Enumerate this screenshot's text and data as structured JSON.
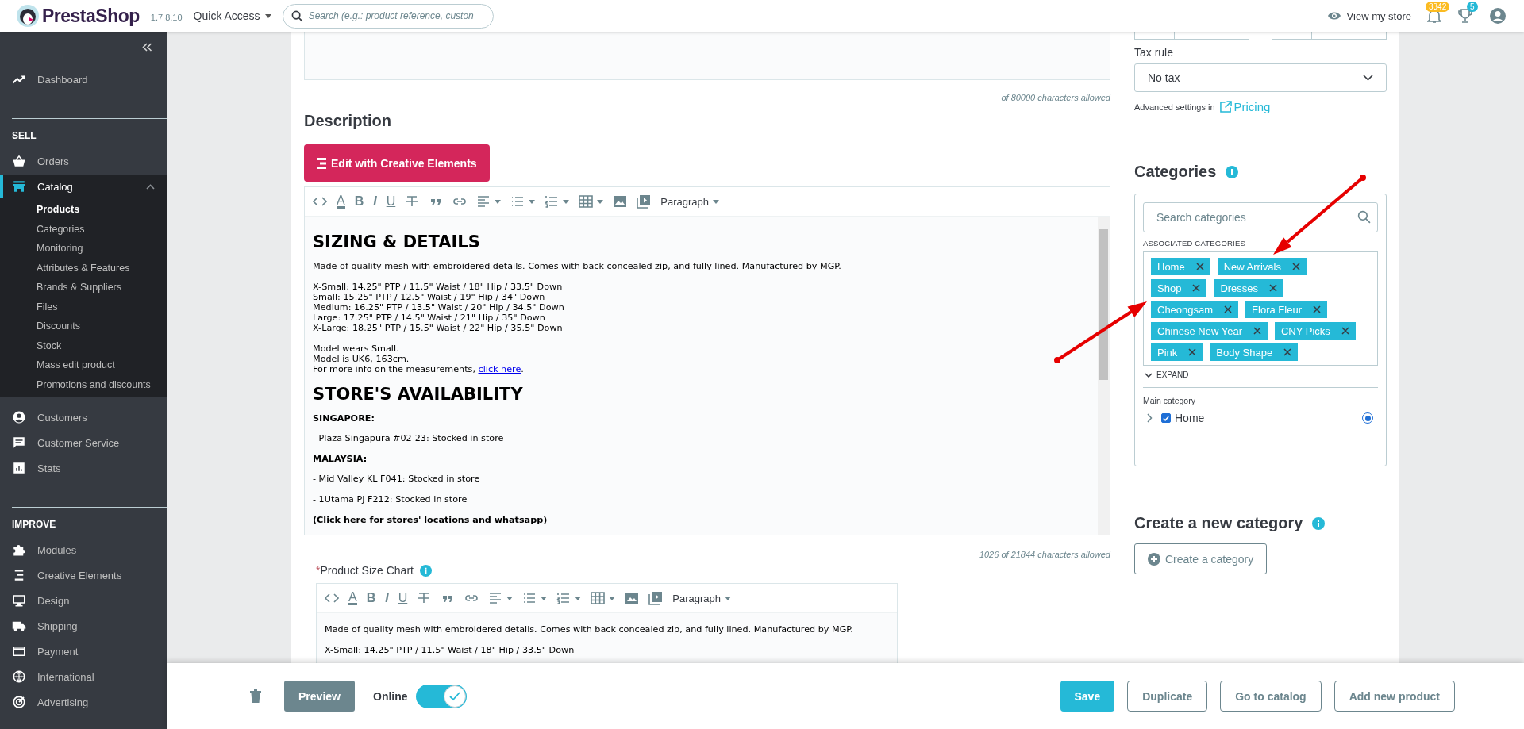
{
  "header": {
    "logo": "PrestaShop",
    "version": "1.7.8.10",
    "quick_access": "Quick Access",
    "search_placeholder": "Search (e.g.: product reference, custon",
    "view_store": "View my store",
    "notifications_badge": "3342",
    "trophy_badge": "5"
  },
  "sidebar": {
    "sections": [
      {
        "items": [
          {
            "label": "Dashboard",
            "selected": false
          }
        ]
      },
      {
        "title": "SELL",
        "items": [
          {
            "label": "Orders",
            "selected": false
          },
          {
            "label": "Catalog",
            "selected": true,
            "expanded": true,
            "children": [
              {
                "label": "Products",
                "selected": true
              },
              {
                "label": "Categories",
                "selected": false
              },
              {
                "label": "Monitoring",
                "selected": false
              },
              {
                "label": "Attributes & Features",
                "selected": false
              },
              {
                "label": "Brands & Suppliers",
                "selected": false
              },
              {
                "label": "Files",
                "selected": false
              },
              {
                "label": "Discounts",
                "selected": false
              },
              {
                "label": "Stock",
                "selected": false
              },
              {
                "label": "Mass edit product",
                "selected": false
              },
              {
                "label": "Promotions and discounts",
                "selected": false
              }
            ]
          },
          {
            "label": "Customers",
            "selected": false
          },
          {
            "label": "Customer Service",
            "selected": false
          },
          {
            "label": "Stats",
            "selected": false
          }
        ]
      },
      {
        "title": "IMPROVE",
        "items": [
          {
            "label": "Modules",
            "selected": false
          },
          {
            "label": "Creative Elements",
            "selected": false
          },
          {
            "label": "Design",
            "selected": false
          },
          {
            "label": "Shipping",
            "selected": false
          },
          {
            "label": "Payment",
            "selected": false
          },
          {
            "label": "International",
            "selected": false
          },
          {
            "label": "Advertising",
            "selected": false
          }
        ]
      }
    ]
  },
  "summary": {
    "counter": "of 80000 characters allowed"
  },
  "description": {
    "title": "Description",
    "button": "Edit with Creative Elements",
    "toolbar": [
      {
        "kind": "code",
        "caret": false
      },
      {
        "kind": "color_letter",
        "text": "A",
        "caret": false
      },
      {
        "kind": "bold_letter",
        "text": "B",
        "caret": false
      },
      {
        "kind": "italic_letter",
        "text": "I",
        "caret": false
      },
      {
        "kind": "underline_letter",
        "text": "U",
        "caret": false
      },
      {
        "kind": "strike",
        "caret": false
      },
      {
        "kind": "quote",
        "caret": false
      },
      {
        "kind": "link",
        "caret": false
      },
      {
        "kind": "align",
        "caret": true
      },
      {
        "kind": "bullets",
        "caret": true
      },
      {
        "kind": "numbers",
        "caret": true
      },
      {
        "kind": "table",
        "caret": true
      },
      {
        "kind": "image",
        "caret": false
      },
      {
        "kind": "media",
        "caret": false
      },
      {
        "kind": "format",
        "text": "Paragraph",
        "caret": true
      }
    ],
    "content": [
      {
        "kind": "heading",
        "text": "SIZING & DETAILS"
      },
      {
        "kind": "paragraph",
        "lines": [
          {
            "text": "Made of quality mesh with embroidered details. Comes with back concealed zip, and fully lined. Manufactured by MGP."
          }
        ]
      },
      {
        "kind": "paragraph",
        "lines": [
          {
            "text": "X-Small: 14.25\" PTP / 11.5\" Waist / 18\" Hip / 33.5\" Down"
          },
          {
            "text": "Small: 15.25\" PTP / 12.5\" Waist / 19\" Hip / 34\" Down"
          },
          {
            "text": "Medium: 16.25\" PTP / 13.5\" Waist / 20\" Hip / 34.5\" Down"
          },
          {
            "text": "Large: 17.25\" PTP / 14.5\" Waist / 21\" Hip / 35\" Down"
          },
          {
            "text": "X-Large: 18.25\" PTP / 15.5\" Waist / 22\" Hip / 35.5\" Down"
          }
        ]
      },
      {
        "kind": "paragraph",
        "lines": [
          {
            "text": "Model wears Small."
          },
          {
            "text": "Model is UK6, 163cm."
          },
          {
            "text": "For more info on the measurements, ",
            "link": "click here",
            "after": "."
          }
        ]
      },
      {
        "kind": "heading",
        "text": "STORE'S AVAILABILITY"
      },
      {
        "kind": "strong",
        "text": "SINGAPORE:"
      },
      {
        "kind": "paragraph",
        "lines": [
          {
            "text": "- Plaza Singapura #02-23: Stocked in store"
          }
        ]
      },
      {
        "kind": "strong",
        "text": "MALAYSIA:"
      },
      {
        "kind": "paragraph",
        "lines": [
          {
            "text": "- Mid Valley KL F041: Stocked in store"
          }
        ]
      },
      {
        "kind": "paragraph",
        "lines": [
          {
            "text": "- 1Utama PJ F212: Stocked in store"
          }
        ]
      },
      {
        "kind": "strong",
        "text": "(Click here for stores' locations and whatsapp)"
      }
    ],
    "counter": "1026 of 21844 characters allowed"
  },
  "size_chart": {
    "required_mark": "*",
    "label": "Product Size Chart",
    "toolbar": [
      {
        "kind": "code",
        "caret": false
      },
      {
        "kind": "color_letter",
        "text": "A",
        "caret": false
      },
      {
        "kind": "bold_letter",
        "text": "B",
        "caret": false
      },
      {
        "kind": "italic_letter",
        "text": "I",
        "caret": false
      },
      {
        "kind": "underline_letter",
        "text": "U",
        "caret": false
      },
      {
        "kind": "strike",
        "caret": false
      },
      {
        "kind": "quote",
        "caret": false
      },
      {
        "kind": "link",
        "caret": false
      },
      {
        "kind": "align",
        "caret": true
      },
      {
        "kind": "bullets",
        "caret": true
      },
      {
        "kind": "numbers",
        "caret": true
      },
      {
        "kind": "table",
        "caret": true
      },
      {
        "kind": "image",
        "caret": false
      },
      {
        "kind": "media",
        "caret": false
      },
      {
        "kind": "format",
        "text": "Paragraph",
        "caret": true
      }
    ],
    "content": [
      {
        "kind": "paragraph",
        "lines": [
          {
            "text": "Made of quality mesh with embroidered details. Comes with back concealed zip, and fully lined. Manufactured by MGP."
          }
        ]
      },
      {
        "kind": "paragraph",
        "lines": [
          {
            "text": "X-Small: 14.25\" PTP / 11.5\" Waist / 18\" Hip / 33.5\" Down"
          }
        ]
      }
    ]
  },
  "tax_rule": {
    "label": "Tax rule",
    "value": "No tax"
  },
  "advanced": {
    "text": "Advanced settings in",
    "link": "Pricing"
  },
  "categories": {
    "title": "Categories",
    "search_placeholder": "Search categories",
    "associated_label": "ASSOCIATED CATEGORIES",
    "tags": [
      "Home",
      "New Arrivals",
      "Shop",
      "Dresses",
      "Cheongsam",
      "Flora Fleur",
      "Chinese New Year",
      "CNY Picks",
      "Pink",
      "Body Shape"
    ],
    "expand": "EXPAND",
    "main_label": "Main category",
    "tree": [
      {
        "label": "Home",
        "expanded": false,
        "checked": true,
        "selected": true
      }
    ]
  },
  "new_category": {
    "title": "Create a new category",
    "button": "Create a category"
  },
  "footer": {
    "preview": "Preview",
    "online": {
      "label": "Online",
      "on": true
    },
    "buttons": [
      {
        "kind": "primary",
        "label": "Save"
      },
      {
        "kind": "outline",
        "label": "Duplicate"
      },
      {
        "kind": "outline",
        "label": "Go to catalog"
      },
      {
        "kind": "outline",
        "label": "Add new product"
      }
    ]
  }
}
